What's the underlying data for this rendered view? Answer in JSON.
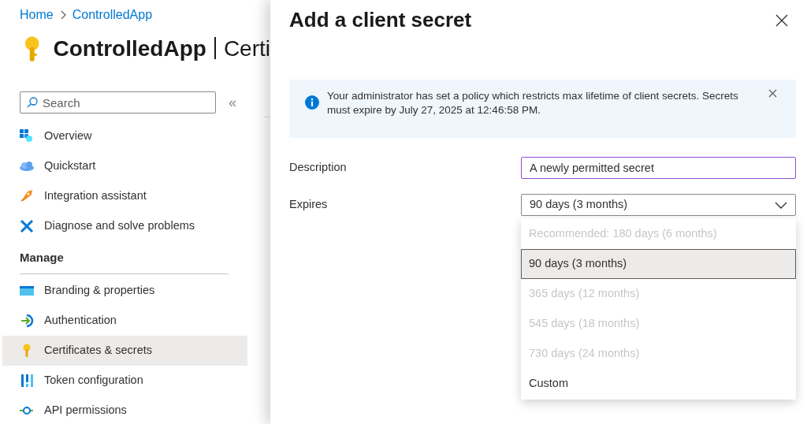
{
  "breadcrumb": [
    "Home",
    "ControlledApp"
  ],
  "page_title": {
    "app": "ControlledApp",
    "section": "Certi"
  },
  "sidebar": {
    "search": {
      "placeholder": "Search"
    },
    "collapse": "«",
    "items": [
      {
        "kind": "grid",
        "label": "Overview",
        "selected": false
      },
      {
        "kind": "cloud",
        "label": "Quickstart",
        "selected": false
      },
      {
        "kind": "rocket",
        "label": "Integration assistant",
        "selected": false
      },
      {
        "kind": "tools",
        "label": "Diagnose and solve problems",
        "selected": false
      }
    ],
    "sections": [
      {
        "heading": "Manage",
        "items": [
          {
            "kind": "web",
            "label": "Branding & properties",
            "selected": false
          },
          {
            "kind": "signin",
            "label": "Authentication",
            "selected": false
          },
          {
            "kind": "key",
            "label": "Certificates & secrets",
            "selected": true
          },
          {
            "kind": "bars",
            "label": "Token configuration",
            "selected": false
          },
          {
            "kind": "api",
            "label": "API permissions",
            "selected": false
          }
        ]
      }
    ]
  },
  "panel": {
    "title": "Add a client secret",
    "notice": "Your administrator has set a policy which restricts max lifetime of client secrets. Secrets must expire by July 27, 2025 at 12:46:58 PM.",
    "description": {
      "label": "Description",
      "value": "A newly permitted secret"
    },
    "expires": {
      "label": "Expires",
      "value": "90 days (3 months)",
      "options": [
        {
          "label": "Recommended: 180 days (6 months)",
          "disabled": true,
          "selected": false
        },
        {
          "label": "90 days (3 months)",
          "disabled": false,
          "selected": true
        },
        {
          "label": "365 days (12 months)",
          "disabled": true,
          "selected": false
        },
        {
          "label": "545 days (18 months)",
          "disabled": true,
          "selected": false
        },
        {
          "label": "730 days (24 months)",
          "disabled": true,
          "selected": false
        },
        {
          "label": "Custom",
          "disabled": false,
          "selected": false
        }
      ]
    }
  }
}
